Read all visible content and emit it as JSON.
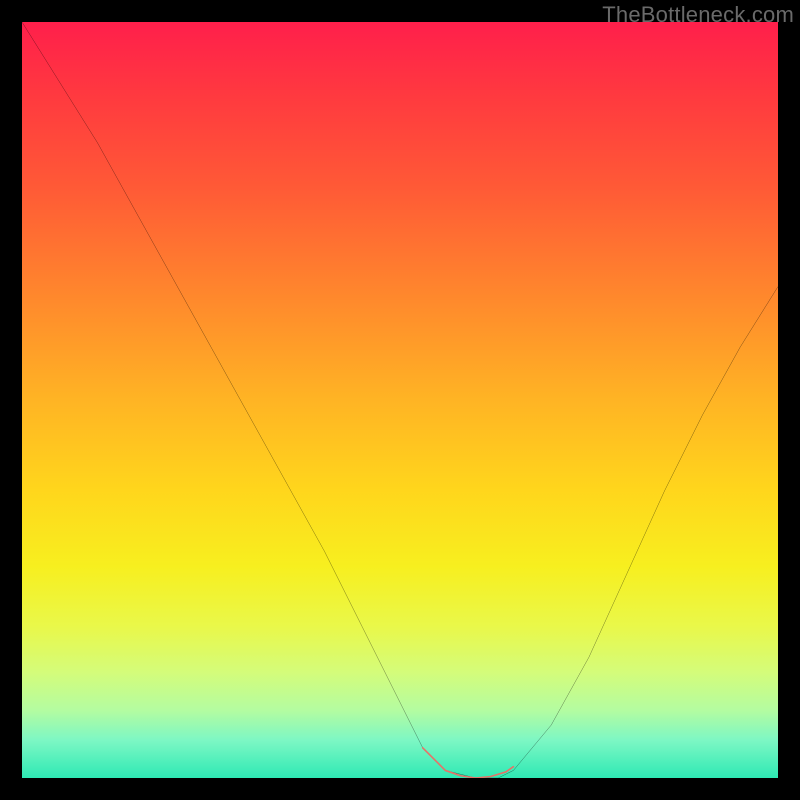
{
  "watermark": "TheBottleneck.com",
  "chart_data": {
    "type": "line",
    "title": "",
    "xlabel": "",
    "ylabel": "",
    "xlim": [
      0,
      100
    ],
    "ylim": [
      0,
      100
    ],
    "background": {
      "gradient_stops": [
        {
          "pos": 0,
          "color": "#ff1f4b"
        },
        {
          "pos": 10,
          "color": "#ff3a3f"
        },
        {
          "pos": 22,
          "color": "#ff5a36"
        },
        {
          "pos": 37,
          "color": "#ff8a2c"
        },
        {
          "pos": 50,
          "color": "#ffb424"
        },
        {
          "pos": 62,
          "color": "#ffd61c"
        },
        {
          "pos": 72,
          "color": "#f7ef1f"
        },
        {
          "pos": 80,
          "color": "#e9f84a"
        },
        {
          "pos": 86,
          "color": "#d4fc7a"
        },
        {
          "pos": 91,
          "color": "#b4fca0"
        },
        {
          "pos": 95,
          "color": "#7df7c4"
        },
        {
          "pos": 100,
          "color": "#2ee9b4"
        }
      ]
    },
    "series": [
      {
        "name": "bottleneck-curve",
        "color": "#000000",
        "x": [
          0,
          5,
          10,
          15,
          20,
          25,
          30,
          35,
          40,
          45,
          50,
          53,
          56,
          60,
          63,
          65,
          70,
          75,
          80,
          85,
          90,
          95,
          100
        ],
        "y": [
          100,
          92,
          84,
          75,
          66,
          57,
          48,
          39,
          30,
          20,
          10,
          4,
          1,
          0,
          0,
          1,
          7,
          16,
          27,
          38,
          48,
          57,
          65
        ]
      }
    ],
    "highlight": {
      "name": "optimal-zone",
      "color": "#e57368",
      "x": [
        53,
        56,
        58,
        60,
        62,
        64,
        65
      ],
      "y": [
        4,
        1,
        0.3,
        0,
        0.2,
        0.8,
        1.5
      ]
    }
  }
}
